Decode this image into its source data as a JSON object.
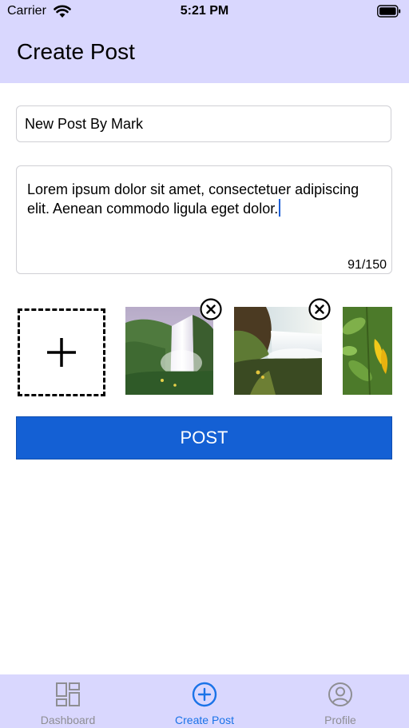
{
  "status_bar": {
    "carrier": "Carrier",
    "time": "5:21 PM",
    "icons": [
      "wifi-icon",
      "battery-icon"
    ]
  },
  "nav": {
    "title": "Create Post"
  },
  "form": {
    "title_value": "New Post By Mark",
    "body_value": "Lorem ipsum dolor sit amet, consectetuer adipiscing elit. Aenean commodo ligula eget dolor.",
    "char_count": "91/150"
  },
  "media": {
    "add_icon": "plus-icon",
    "remove_icon": "close-circle-icon",
    "photos": [
      {
        "subject": "waterfall"
      },
      {
        "subject": "waterfall"
      },
      {
        "subject": "yellow-flower"
      }
    ]
  },
  "actions": {
    "post_label": "POST"
  },
  "tab_bar": {
    "tabs": [
      {
        "label": "Dashboard",
        "icon": "dashboard-icon",
        "active": false
      },
      {
        "label": "Create Post",
        "icon": "plus-circle-icon",
        "active": true
      },
      {
        "label": "Profile",
        "icon": "profile-icon",
        "active": false
      }
    ]
  },
  "colors": {
    "bar_background": "#d9d7fe",
    "primary": "#1460d4",
    "tab_active": "#1a73e8",
    "tab_inactive": "#8e8e93"
  }
}
